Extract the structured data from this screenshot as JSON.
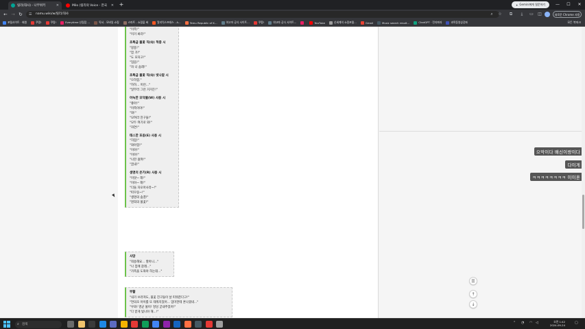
{
  "tabs": [
    {
      "title": "릴리(대사) - 나무위키",
      "active": true,
      "color": "#00a495"
    },
    {
      "title": "Milo (릴리의 Voice - 한국",
      "active": false,
      "color": "#ff0000"
    }
  ],
  "header": {
    "gemini_label": "Gemini에게 질문하기",
    "url": "namu.wiki/w/릴리/대사",
    "update_label": "새로운 Chrome 사용 가능"
  },
  "bookmarks": [
    {
      "label": "포털사이트 · 회원",
      "color": "#4285f4"
    },
    {
      "label": "쿠팡!",
      "color": "#e53935"
    },
    {
      "label": "쿠팡!",
      "color": "#e53935"
    },
    {
      "label": "Everytime 신림점 …",
      "color": "#e91e63"
    },
    {
      "label": "독서 - 모바일 쇼핑",
      "color": "#795548"
    },
    {
      "label": "스마트 - 쇼핑을 써",
      "color": "#8d6e63"
    },
    {
      "label": "알리익스프레스 - A…",
      "color": "#ff5722"
    },
    {
      "label": "Temu Republic of K…",
      "color": "#ff7043"
    },
    {
      "label": "야고마 공식 사이트…",
      "color": "#607d8b"
    },
    {
      "label": "쿠팡!",
      "color": "#e53935"
    },
    {
      "label": "야고마 공식 사이트…",
      "color": "#607d8b"
    },
    {
      "label": "",
      "color": "#e91e63"
    },
    {
      "label": "YouTube",
      "color": "#ff0000"
    },
    {
      "label": "신세계의 쇼핑포털…",
      "color": "#9e9e9e"
    },
    {
      "label": "Gmail",
      "color": "#ea4335"
    },
    {
      "label": "Music search result…",
      "color": "#455a64"
    },
    {
      "label": "ChatGPT · 전자파자",
      "color": "#10a37f"
    },
    {
      "label": "과목동영상강좌",
      "color": "#3f51b5"
    }
  ],
  "bookmarks_all_label": "모든 북마크",
  "content": {
    "box1": [
      {
        "heading": "",
        "lines": [
          "\"이쪽!\"",
          "\"이거 봐라!\""
        ]
      },
      {
        "heading": "초특급 불꽃 직(Q) 적중 시",
        "lines": [
          "\"뭉뚱!\"",
          "\"잡 가!\"",
          "\"도 모자고!\"",
          "\"엄음!\"",
          "\"자 너 숨래!\""
        ]
      },
      {
        "heading": "초특급 불꽃 직(Q) 빗나갈 시",
        "lines": [
          "\"으하함.\"",
          "\"하하... 이런...\"",
          "\"일부러 그런 거거든!\""
        ]
      },
      {
        "heading": "아늑한 모닥불(W) 사용 시",
        "lines": [
          "\"좋아!\"",
          "\"이쪽이야!\"",
          "\"와!\"",
          "\"모여라 친구들!\"",
          "\"모두 여기로 와!\"",
          "\"자연!\""
        ]
      },
      {
        "heading": "태스한 포옹(E) 사용 시",
        "lines": [
          "\"히힘!\"",
          "\"와아힝!\"",
          "\"이야!\"",
          "\"이야!\"",
          "\"나한 왔여!\"",
          "\"꿈내!\""
        ]
      },
      {
        "heading": "생명의 온기(R) 사용 시",
        "lines": [
          "\"이얏~ 해!\"",
          "\"이야~ 해!\"",
          "\"다들 자오아사라~!\"",
          "\"따꾸웅~!\"",
          "\"생명의 숨결!\"",
          "\"뭔희의 불꽃!\""
        ]
      }
    ],
    "box2": [
      {
        "heading": "사망",
        "lines": [
          "\"죄송해요... 할아니...\"",
          "\"나 집에 갈래...\"",
          "\"가족을 도와야 하는데...\""
        ]
      }
    ],
    "box3": [
      {
        "heading": "부활",
        "lines": [
          "\"내가 쓰러져도, 불꽃 친구들이 날 피워준다고!\"",
          "\"연의조 아이를 또 태워지었어... 엄마한테 혼나겠네...\"",
          "\"우와! 영균 불이! 엉덩 굳내주었어!\"",
          "\"다 받게 빛나야 해...!\""
        ]
      }
    ]
  },
  "chat": [
    {
      "text": "으악이다 배신이랑이다"
    },
    {
      "text": "다이게"
    },
    {
      "text": "ㅋㅋㅋㅋㅋㅋㅋㅋ 이이혼"
    }
  ],
  "taskbar": {
    "search_placeholder": "검색",
    "time": "오전 1:42",
    "date": "2024-09-24"
  }
}
